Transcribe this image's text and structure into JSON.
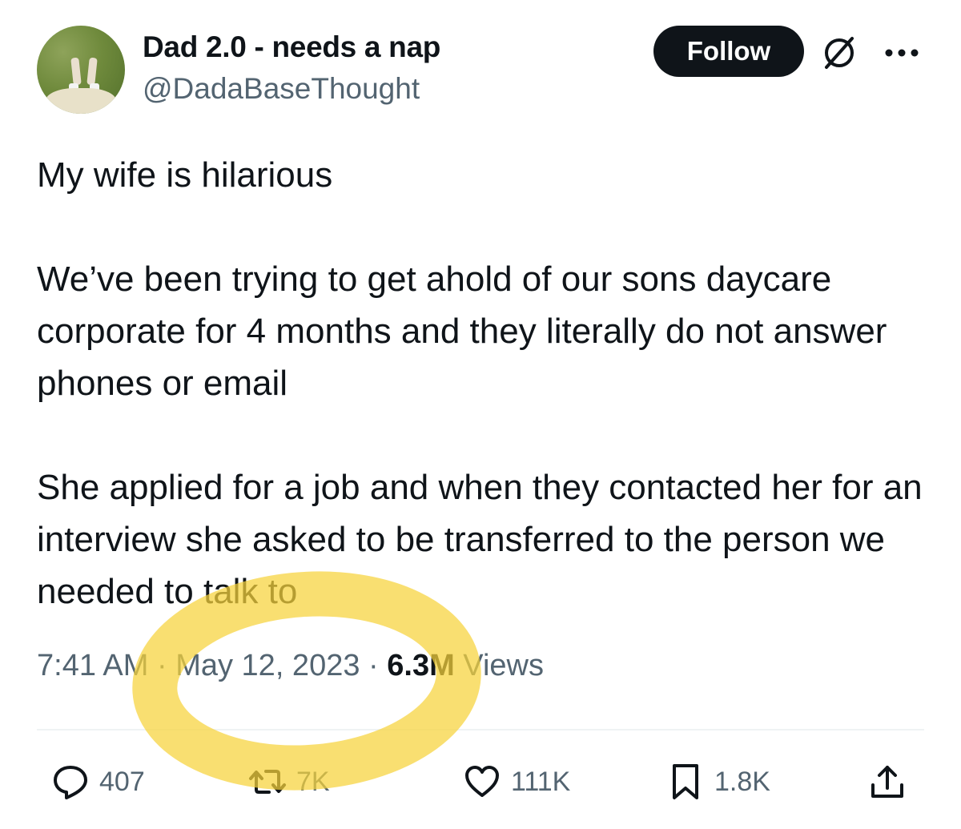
{
  "author": {
    "display_name": "Dad 2.0 - needs a nap",
    "handle": "@DadaBaseThought"
  },
  "header": {
    "follow_label": "Follow",
    "icons": [
      "grok-icon",
      "more-icon"
    ]
  },
  "tweet": {
    "paragraphs": [
      "My wife is hilarious",
      "We’ve been trying to get ahold of our sons daycare corporate for 4 months and they literally do not answer phones or email",
      "She applied for a job and when they contacted her for an interview she asked to be transferred to the person we needed to talk to"
    ],
    "time": "7:41 AM",
    "date": "May 12, 2023",
    "views_count": "6.3M",
    "views_label": "Views",
    "separator": "·"
  },
  "actions": {
    "replies": "407",
    "retweets": "7K",
    "likes": "111K",
    "bookmarks": "1.8K"
  },
  "colors": {
    "text": "#0f1419",
    "secondary": "#536471",
    "highlight": "#f7d33a"
  }
}
